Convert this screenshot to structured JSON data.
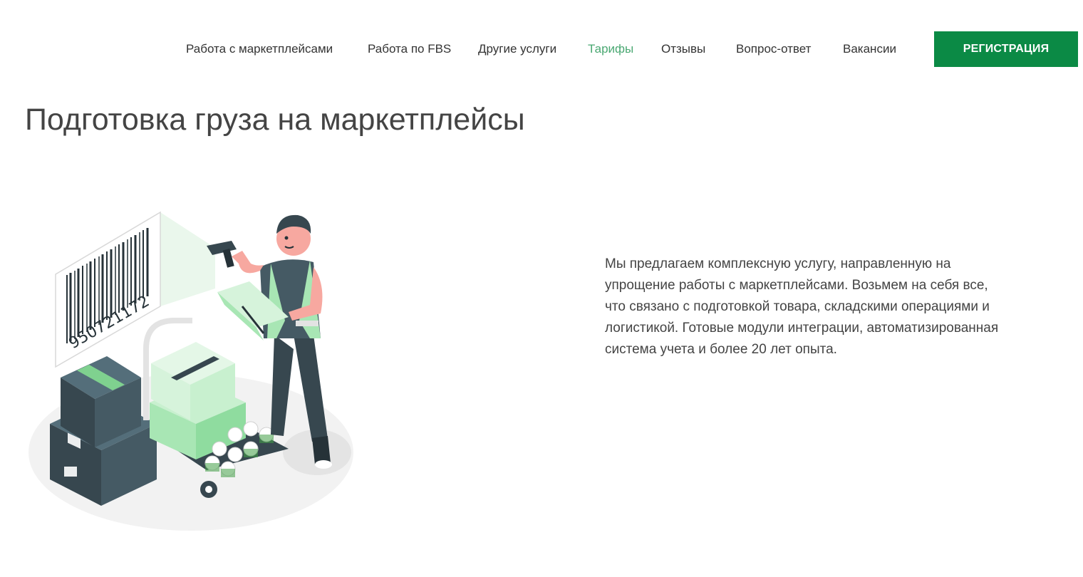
{
  "nav": {
    "items": [
      {
        "label": "Работа с маркетплейсами",
        "active": false
      },
      {
        "label": "Работа по FBS",
        "active": false
      },
      {
        "label": "Другие услуги",
        "active": false
      },
      {
        "label": "Тарифы",
        "active": true
      },
      {
        "label": "Отзывы",
        "active": false
      },
      {
        "label": "Вопрос-ответ",
        "active": false
      },
      {
        "label": "Вакансии",
        "active": false
      }
    ],
    "register_label": "РЕГИСТРАЦИЯ"
  },
  "main": {
    "title": "Подготовка груза на маркетплейсы",
    "description": "Мы предлагаем комплексную услугу, направленную на упрощение работы с маркетплейсами. Возьмем на себя все, что связано с подготовкой товара, складскими операциями и логистикой. Готовые модули интеграции, автоматизированная система учета и более 20 лет опыта."
  },
  "illustration": {
    "barcode_number": "950721172",
    "icon": "warehouse-worker-scanning-illustration"
  },
  "colors": {
    "accent": "#0b8a45",
    "active_nav": "#4aa872",
    "light_green": "#a8e6b4",
    "dark_box": "#37474f"
  }
}
